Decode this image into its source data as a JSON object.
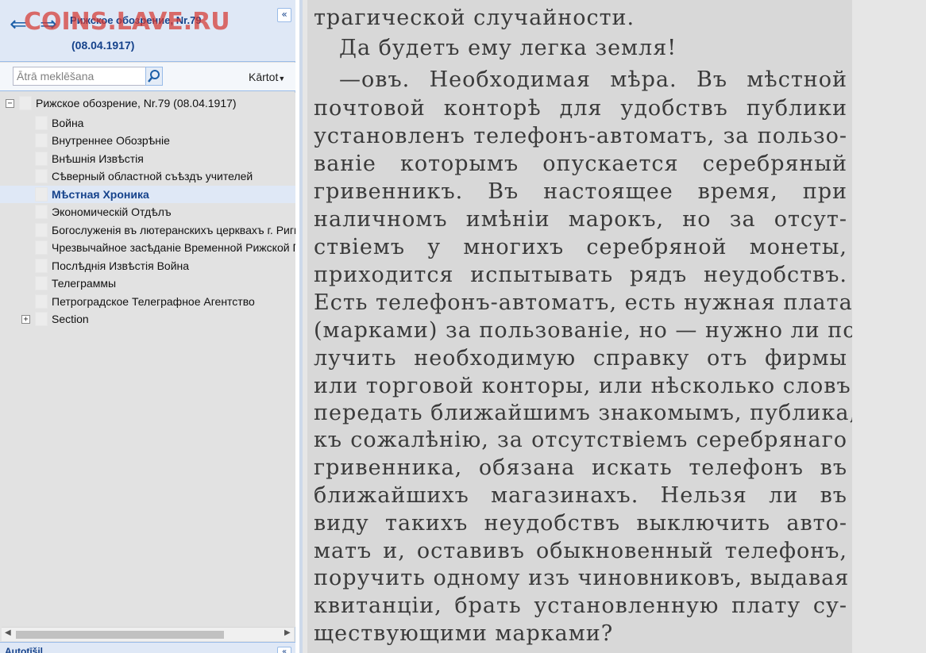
{
  "header": {
    "title": "Рижское обозрение, Nr.79",
    "date": "(08.04.1917)",
    "watermark": "COINS.LAVE.RU"
  },
  "toolbar": {
    "search_placeholder": "Ātrā meklēšana",
    "kartot_label": "Kārtot"
  },
  "tree": {
    "root": "Рижское обозрение, Nr.79 (08.04.1917)",
    "items": [
      "Война",
      "Внутреннее Обозрѣніе",
      "Внѣшнія Извѣстія",
      "Сѣверный областной съѣздъ учителей",
      "Мѣстная Хроника",
      "Экономическій Отдѣлъ",
      "Богослуженія въ лютеранскихъ церквахъ г. Риги",
      "Чрезвычайное засѣданіе Временной Рижской Го",
      "Послѣднія Извѣстія Война",
      "Телеграммы",
      "Петроградское Телеграфное Агентство",
      "Section"
    ],
    "selected_index": 4
  },
  "bottom_panel": {
    "title": "Autotīšil"
  },
  "page_text": [
    "трагической случайности.",
    "Да будетъ ему легка земля!",
    "—овъ. Необходимая мѣра. Въ мѣстной",
    "почтовой конторѣ для удобствъ публики",
    "установленъ телефонъ-автоматъ, за пользо-",
    "ваніе которымъ опускается серебряный",
    "гривенникъ. Въ настоящее время, при",
    "наличномъ имѣніи марокъ, но за отсут-",
    "ствіемъ у многихъ серебряной монеты,",
    "приходится испытывать рядъ неудобствъ.",
    "Есть телефонъ-автоматъ, есть нужная плата",
    "(марками) за пользованіе, но — нужно ли по-",
    "лучить необходимую справку отъ фирмы",
    "или торговой конторы, или нѣсколько словъ",
    "передать ближайшимъ знакомымъ, публика,",
    "къ сожалѣнію, за отсутствіемъ серебрянаго",
    "гривенника, обязана искать телефонъ въ",
    "ближайшихъ магазинахъ. Нельзя ли въ",
    "виду такихъ неудобствъ выключить авто-",
    "матъ и, оставивъ обыкновенный телефонъ,",
    "поручить одному изъ чиновниковъ, выдавая",
    "квитанціи, брать установленную плату су-",
    "ществующими марками?"
  ]
}
